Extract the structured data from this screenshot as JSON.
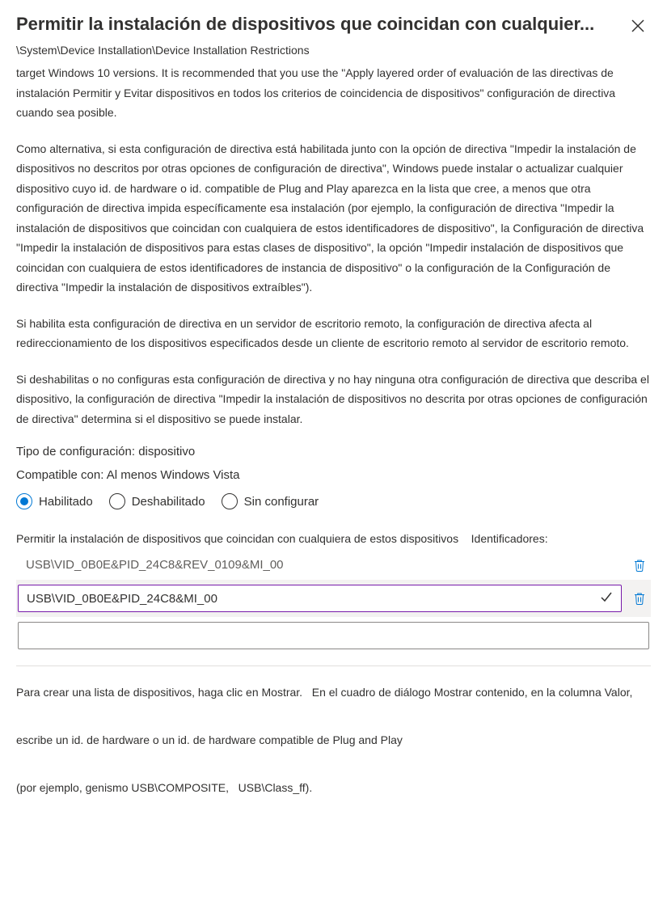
{
  "header": {
    "title": "Permitir la instalación de dispositivos que coincidan con cualquier...",
    "breadcrumb": "\\System\\Device Installation\\Device Installation Restrictions"
  },
  "description": {
    "para1": "target Windows 10 versions. It is recommended that you use the \"Apply layered order of evaluación de las directivas de instalación Permitir y Evitar dispositivos en todos los criterios de coincidencia de dispositivos\" configuración de directiva cuando sea posible.",
    "para2": "Como alternativa, si esta configuración de directiva está habilitada junto con la opción de directiva \"Impedir la instalación de dispositivos no descritos por otras opciones de configuración de directiva\", Windows puede instalar o actualizar cualquier dispositivo cuyo id. de hardware o id. compatible de Plug and Play aparezca en la lista que cree, a menos que otra configuración de directiva impida específicamente esa instalación (por ejemplo,  la configuración de directiva \"Impedir la instalación de dispositivos que coincidan con cualquiera de estos identificadores de dispositivo\", la Configuración de directiva \"Impedir la instalación de dispositivos para estas clases de dispositivo\", la opción \"Impedir instalación de dispositivos que coincidan con cualquiera de estos identificadores de instancia de dispositivo\" o la configuración de la Configuración de directiva \"Impedir la instalación de dispositivos extraíbles\").",
    "para3": "Si habilita esta configuración de directiva en un servidor de escritorio remoto, la configuración de directiva afecta al redireccionamiento de los dispositivos especificados desde un cliente de escritorio remoto al servidor de escritorio remoto.",
    "para4": "Si deshabilitas o no configuras esta configuración de directiva y no hay ninguna otra configuración de directiva que describa el dispositivo, la configuración de directiva \"Impedir la instalación de dispositivos no descrita por otras opciones de configuración de directiva\" determina si el dispositivo se puede instalar."
  },
  "meta": {
    "setting_type": "Tipo de configuración: dispositivo",
    "supported_on": "Compatible con: Al menos Windows Vista"
  },
  "radios": {
    "enabled": "Habilitado",
    "disabled": "Deshabilitado",
    "not_configured": "Sin configurar",
    "selected": "enabled"
  },
  "list": {
    "label_left": "Permitir la instalación de dispositivos que coincidan con cualquiera de estos dispositivos",
    "label_right": "Identificadores:",
    "items": [
      {
        "value": "USB\\VID_0B0E&PID_24C8&REV_0109&MI_00",
        "editing": false
      },
      {
        "value": "USB\\VID_0B0E&PID_24C8&MI_00",
        "editing": true
      }
    ]
  },
  "footer": {
    "t1": "Para crear una lista de dispositivos, haga clic en Mostrar.",
    "t2": "En el cuadro de diálogo Mostrar contenido, en la columna Valor,",
    "t3": "escribe un id. de hardware o un id. de hardware compatible de Plug and Play",
    "t4": "(por ejemplo, genismo USB\\COMPOSITE,",
    "t5": "USB\\Class_ff)."
  }
}
